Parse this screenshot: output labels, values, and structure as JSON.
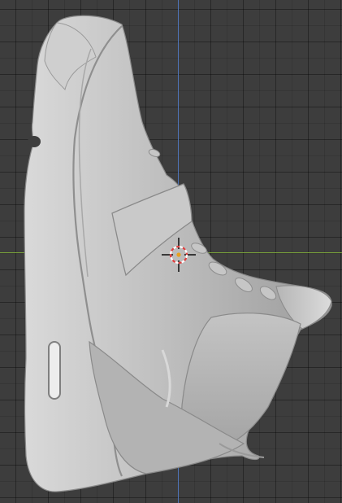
{
  "viewport": {
    "background": "#3d3d3d",
    "grid_visible": true,
    "axis_x_color": "#7aa33a",
    "axis_y_color": "#4f75b8"
  },
  "model": {
    "object": "sneaker-mesh",
    "shading": "solid",
    "base_color": "#b8b8b8"
  },
  "cursor": {
    "icon": "3d-cursor-icon",
    "ring_color_a": "#e04040",
    "ring_color_b": "#ffffff"
  }
}
